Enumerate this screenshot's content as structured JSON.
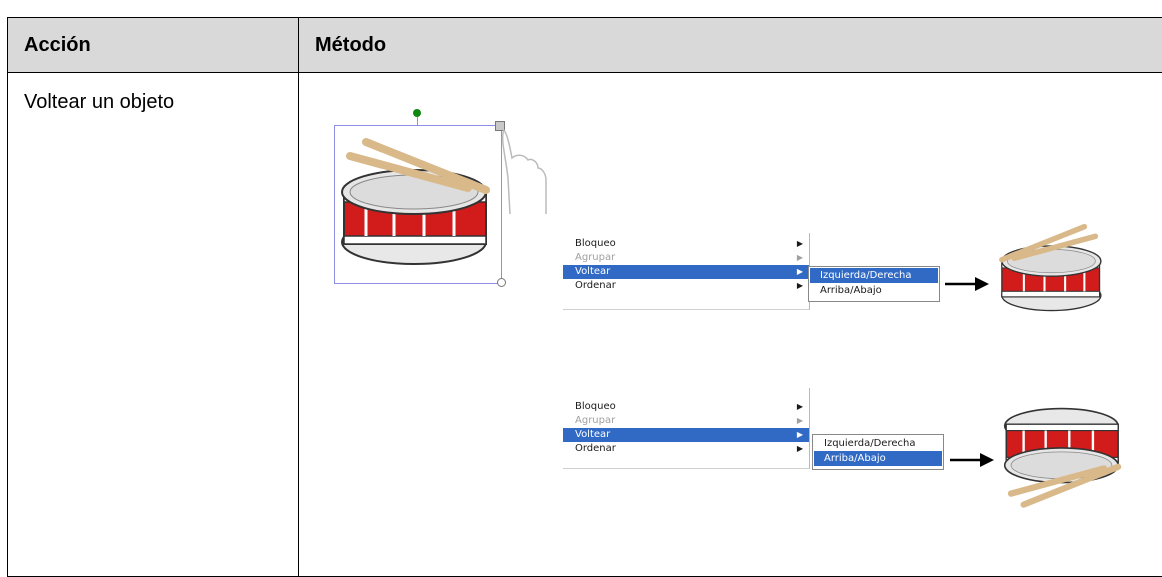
{
  "table": {
    "header": {
      "accion": "Acción",
      "metodo": "Método"
    },
    "row": {
      "accion": "Voltear un objeto"
    }
  },
  "menu_top": {
    "items": [
      {
        "label": "Bloqueo",
        "state": "normal"
      },
      {
        "label": "Agrupar",
        "state": "disabled"
      },
      {
        "label": "Voltear",
        "state": "active"
      },
      {
        "label": "Ordenar",
        "state": "normal"
      }
    ],
    "submenu": [
      {
        "label": "Izquierda/Derecha",
        "state": "active"
      },
      {
        "label": "Arriba/Abajo",
        "state": "normal"
      }
    ]
  },
  "menu_bottom": {
    "items": [
      {
        "label": "Bloqueo",
        "state": "normal"
      },
      {
        "label": "Agrupar",
        "state": "disabled"
      },
      {
        "label": "Voltear",
        "state": "active"
      },
      {
        "label": "Ordenar",
        "state": "normal"
      }
    ],
    "submenu": [
      {
        "label": "Izquierda/Derecha",
        "state": "normal"
      },
      {
        "label": "Arriba/Abajo",
        "state": "active"
      }
    ]
  },
  "colors": {
    "header_bg": "#d9d9d9",
    "menu_highlight": "#316ac5",
    "drum_red": "#d21c1c",
    "stick": "#d9b98a",
    "selection": "#8e8ee6"
  },
  "icons": [
    "drum-image",
    "rotation-handle",
    "menu-handle",
    "pointer-hand-icon",
    "arrow-right-icon"
  ]
}
